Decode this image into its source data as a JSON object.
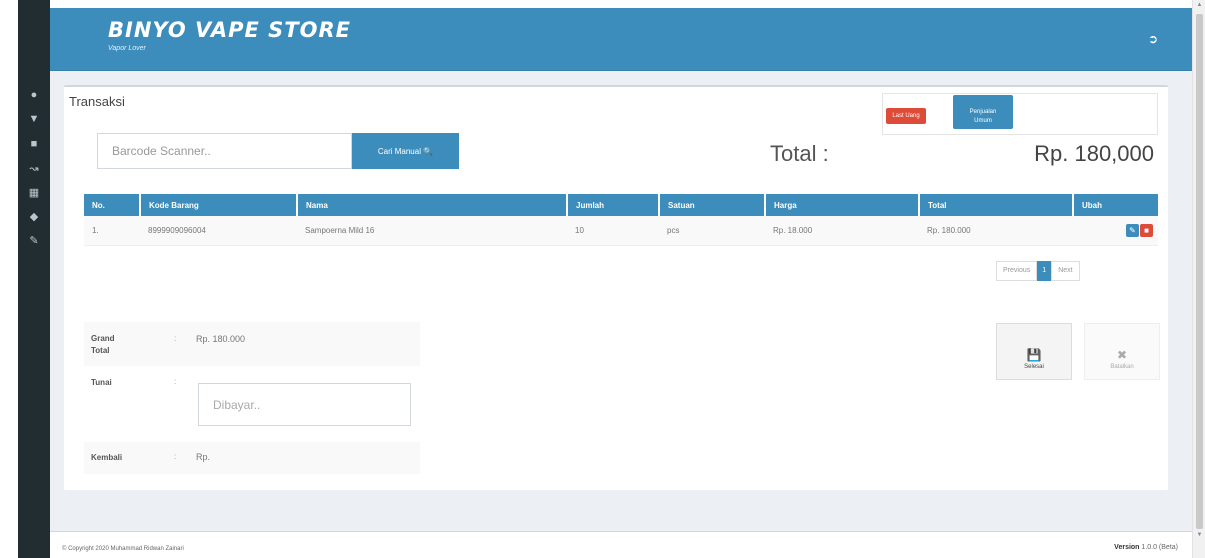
{
  "sidebar": {
    "icons": [
      "dashboard-icon",
      "cart-icon",
      "book-icon",
      "chart-icon",
      "report-icon",
      "users-icon",
      "wrench-icon"
    ]
  },
  "header": {
    "brand": "BINYO VAPE STORE",
    "subtitle": "Vapor Lover"
  },
  "box": {
    "title": "Transaksi",
    "last_uang_label": "Last Uang",
    "penjualan_label_1": "Penjualan",
    "penjualan_label_2": "Umum"
  },
  "search": {
    "placeholder": "Barcode Scanner..",
    "cari_label": "Cari Manual 🔍"
  },
  "total": {
    "label": "Total :",
    "value": "Rp. 180,000"
  },
  "table": {
    "headers": [
      "No.",
      "Kode Barang",
      "Nama",
      "Jumlah",
      "Satuan",
      "Harga",
      "Total",
      "Ubah"
    ],
    "rows": [
      {
        "no": "1.",
        "kode": "8999909096004",
        "nama": "Sampoerna Mild 16",
        "jumlah": "10",
        "satuan": "pcs",
        "harga": "Rp. 18.000",
        "total": "Rp. 180.000"
      }
    ]
  },
  "pagination": {
    "previous": "Previous",
    "current": "1",
    "next": "Next"
  },
  "summary": {
    "grand_total_label_1": "Grand",
    "grand_total_label_2": "Total",
    "grand_total_value": "Rp. 180.000",
    "tunai_label": "Tunai",
    "tunai_placeholder": "Dibayar..",
    "kembali_label": "Kembali",
    "kembali_value": "Rp.",
    "colon": ":"
  },
  "actions": {
    "selesai_label": "Selesai",
    "batal_label": "Batalkan"
  },
  "footer": {
    "copyright": "© Copyright 2020 Muhammad Ridwan Zainari",
    "version_label": "Version",
    "version_value": "1.0.0 (Beta)"
  }
}
